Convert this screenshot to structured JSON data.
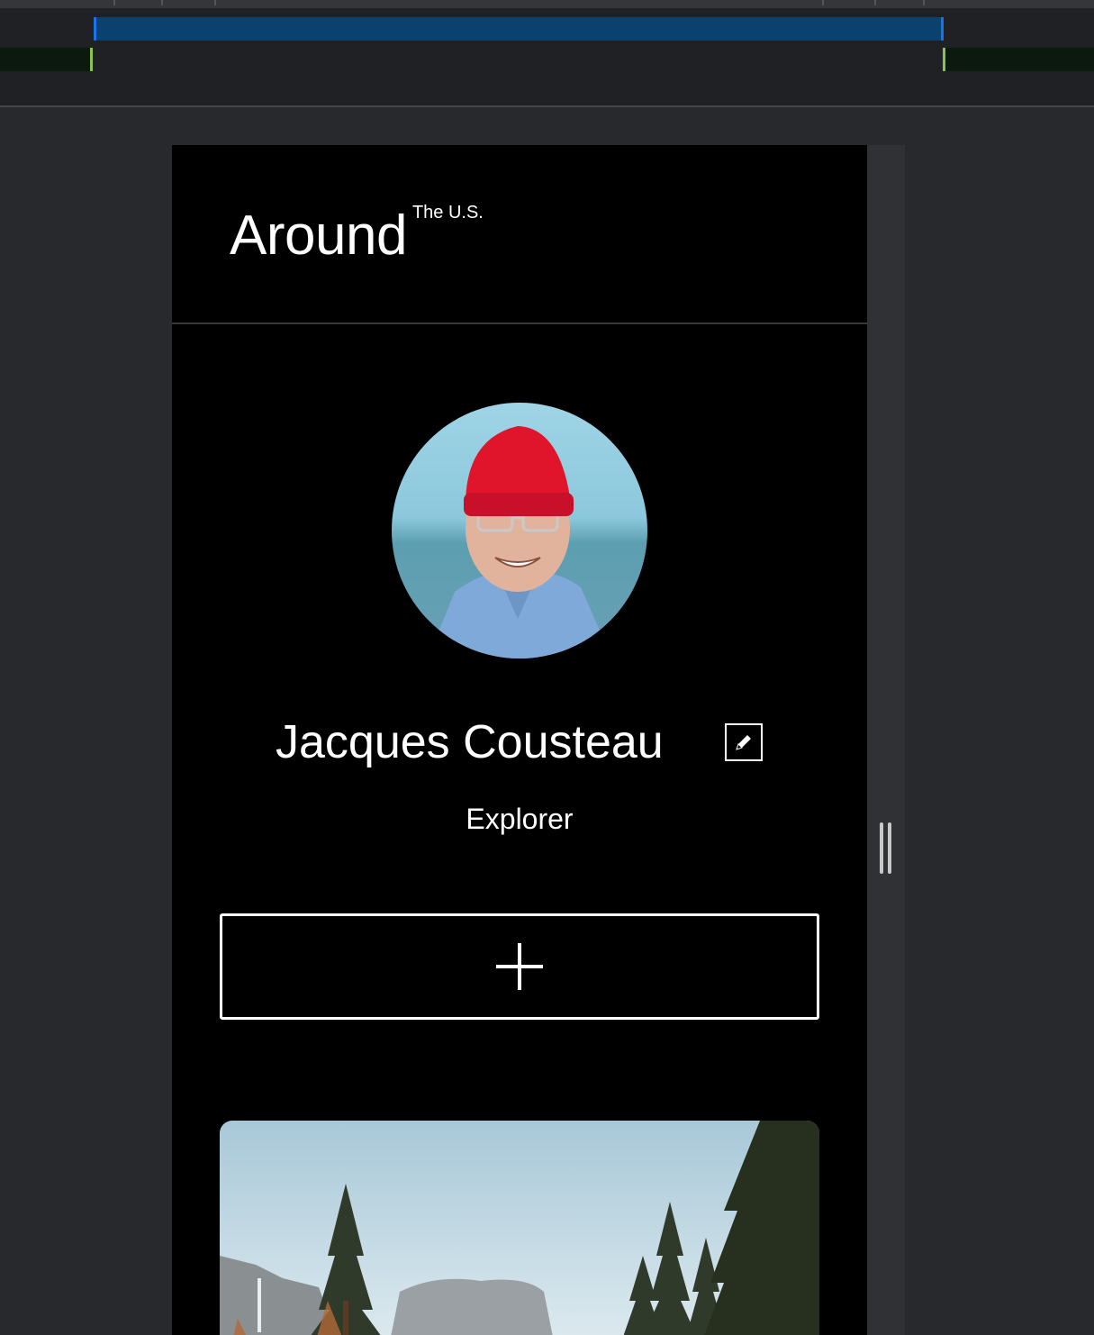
{
  "header": {
    "logo_main": "Around",
    "logo_sup": "The U.S."
  },
  "profile": {
    "name": "Jacques Cousteau",
    "about": "Explorer",
    "avatar_icon": "avatar-photo",
    "edit_icon": "pencil-icon"
  },
  "actions": {
    "add_icon": "plus-icon"
  },
  "colors": {
    "page_background": "#000000",
    "text": "#ffffff",
    "devtools_background": "#202124",
    "media_query_blue": "#0b416f",
    "media_query_green": "#8bc34a"
  }
}
